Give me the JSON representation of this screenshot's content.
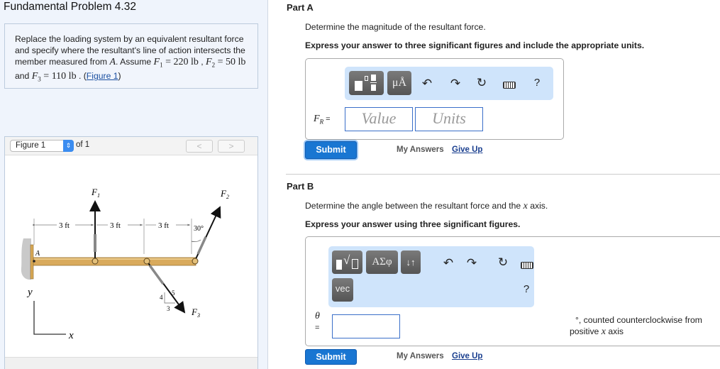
{
  "problem": {
    "title": "Fundamental Problem 4.32",
    "text_1": "Replace the loading system by an equivalent resultant force and specify where the resultant's line of action intersects the member measured from ",
    "point": "A",
    "text_2": ". Assume ",
    "f1_sym": "F",
    "f1_sub": "1",
    "eq": " = ",
    "f1_val": "220 lb",
    "comma": " , ",
    "f2_sym": "F",
    "f2_sub": "2",
    "f2_val": "50 lb",
    "and": " and ",
    "f3_sym": "F",
    "f3_sub": "3",
    "f3_val": "110 lb",
    "end": " . (",
    "figure_link": "Figure 1",
    "close": ")"
  },
  "figure": {
    "selected": "Figure 1",
    "of": "of 1",
    "prev": "<",
    "next": ">",
    "labels": {
      "F1": "F",
      "F1_sub": "1",
      "F2": "F",
      "F2_sub": "2",
      "F3": "F",
      "F3_sub": "3",
      "dim1": "3 ft",
      "dim2": "3 ft",
      "dim3": "3 ft",
      "angle": "30°",
      "A": "A",
      "y": "y",
      "x": "x",
      "s4": "4",
      "s5": "5",
      "s3": "3"
    }
  },
  "partA": {
    "heading": "Part A",
    "question": "Determine the magnitude of the resultant force.",
    "instruction": "Express your answer to three significant figures and include the appropriate units.",
    "toolbar": {
      "units_btn": "μÅ",
      "help": "?"
    },
    "label": "F",
    "label_sub": "R",
    "label_eq": " =",
    "value_placeholder": "Value",
    "units_placeholder": "Units",
    "submit": "Submit",
    "my_answers": "My Answers",
    "give_up": "Give Up"
  },
  "partB": {
    "heading": "Part B",
    "question_1": "Determine the angle between the resultant force and the ",
    "question_x": "x",
    "question_2": " axis.",
    "instruction": "Express your answer using three significant figures.",
    "toolbar": {
      "greek_btn": "ΑΣφ",
      "sort_btn": "↓↑",
      "vec_btn": "vec",
      "help": "?"
    },
    "label": "θ",
    "label_eq": "=",
    "value": "",
    "suffix_1": "°, counted counterclockwise from",
    "suffix_2a": "positive ",
    "suffix_x": "x",
    "suffix_2b": " axis",
    "submit": "Submit",
    "my_answers": "My Answers",
    "give_up": "Give Up"
  },
  "colors": {
    "accent": "#1976d2",
    "toolbar": "#cfe4fb",
    "beam": "#d9aa5c",
    "left_bg": "#eff4fc"
  }
}
